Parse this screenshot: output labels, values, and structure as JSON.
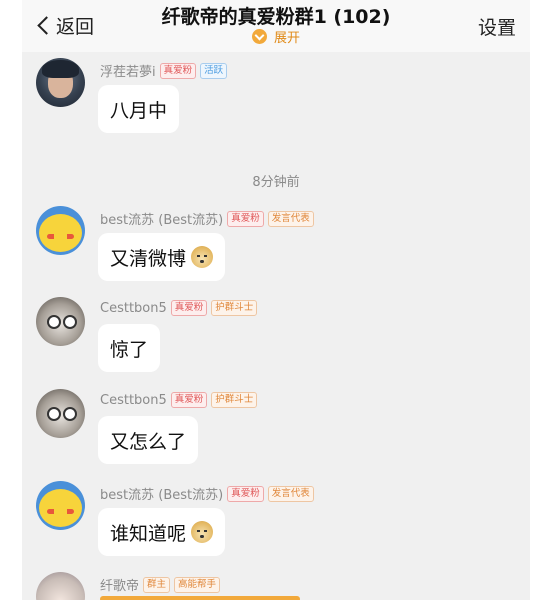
{
  "header": {
    "back_label": "返回",
    "title": "纤歌帝的真爱粉群1 (102)",
    "subtitle": "展开",
    "settings_label": "设置"
  },
  "time_separator": "8分钟前",
  "messages": [
    {
      "sender": "浮茬若夢i",
      "badges": [
        "真爱粉",
        "活跃"
      ],
      "text": "八月中",
      "avatar_icon": "dark-hair-avatar-icon"
    },
    {
      "sender": "best流苏 (Best流苏)",
      "badges": [
        "真爱粉",
        "发言代表"
      ],
      "text": "又清微博",
      "emoji": "doge-emoji-icon",
      "avatar_icon": "pikachu-avatar-icon"
    },
    {
      "sender": "Cesttbon5",
      "badges": [
        "真爱粉",
        "护群斗士"
      ],
      "text": "惊了",
      "avatar_icon": "cat-glasses-avatar-icon"
    },
    {
      "sender": "Cesttbon5",
      "badges": [
        "真爱粉",
        "护群斗士"
      ],
      "text": "又怎么了",
      "avatar_icon": "cat-glasses-avatar-icon"
    },
    {
      "sender": "best流苏 (Best流苏)",
      "badges": [
        "真爱粉",
        "发言代表"
      ],
      "text": "谁知道呢",
      "emoji": "doge-emoji-icon",
      "avatar_icon": "pikachu-avatar-icon"
    },
    {
      "sender": "纤歌帝",
      "badges": [
        "群主",
        "高能帮手"
      ],
      "avatar_icon": "anime-avatar-icon"
    }
  ],
  "colors": {
    "accent_orange": "#e08a17",
    "badge_red": "#e0595a",
    "badge_blue": "#4a9be0",
    "badge_orange": "#e0873a",
    "chat_background": "#f0f0f0"
  }
}
